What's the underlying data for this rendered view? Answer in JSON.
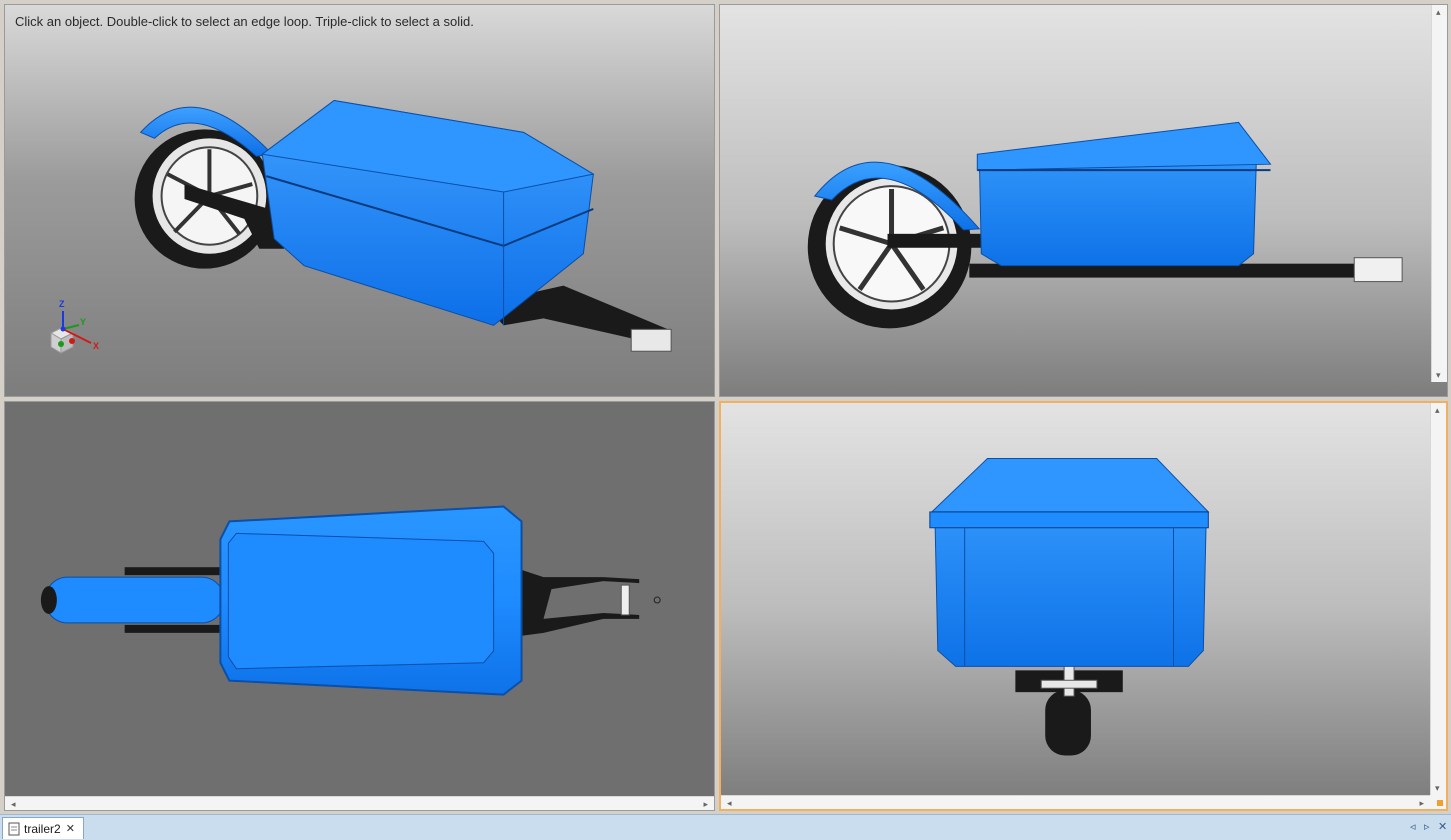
{
  "viewports": {
    "top_left": {
      "hint": "Click an object. Double-click to select an edge loop. Triple-click to select a solid.",
      "triad": {
        "z": "Z",
        "y": "Y",
        "x": "X"
      }
    },
    "top_right": {},
    "bottom_left": {},
    "bottom_right": {
      "active": true
    }
  },
  "scroll": {
    "left": "◂",
    "right": "▸",
    "up": "▴",
    "down": "▾"
  },
  "tabbar": {
    "tab_label": "trailer2",
    "tab_close": "✕",
    "nav_prev": "◃",
    "nav_next": "▹",
    "nav_close": "✕"
  },
  "colors": {
    "body": "#1e8bff",
    "body_dark": "#0b5fd0",
    "frame": "#1a1a1a",
    "active_border": "#f0b060"
  }
}
